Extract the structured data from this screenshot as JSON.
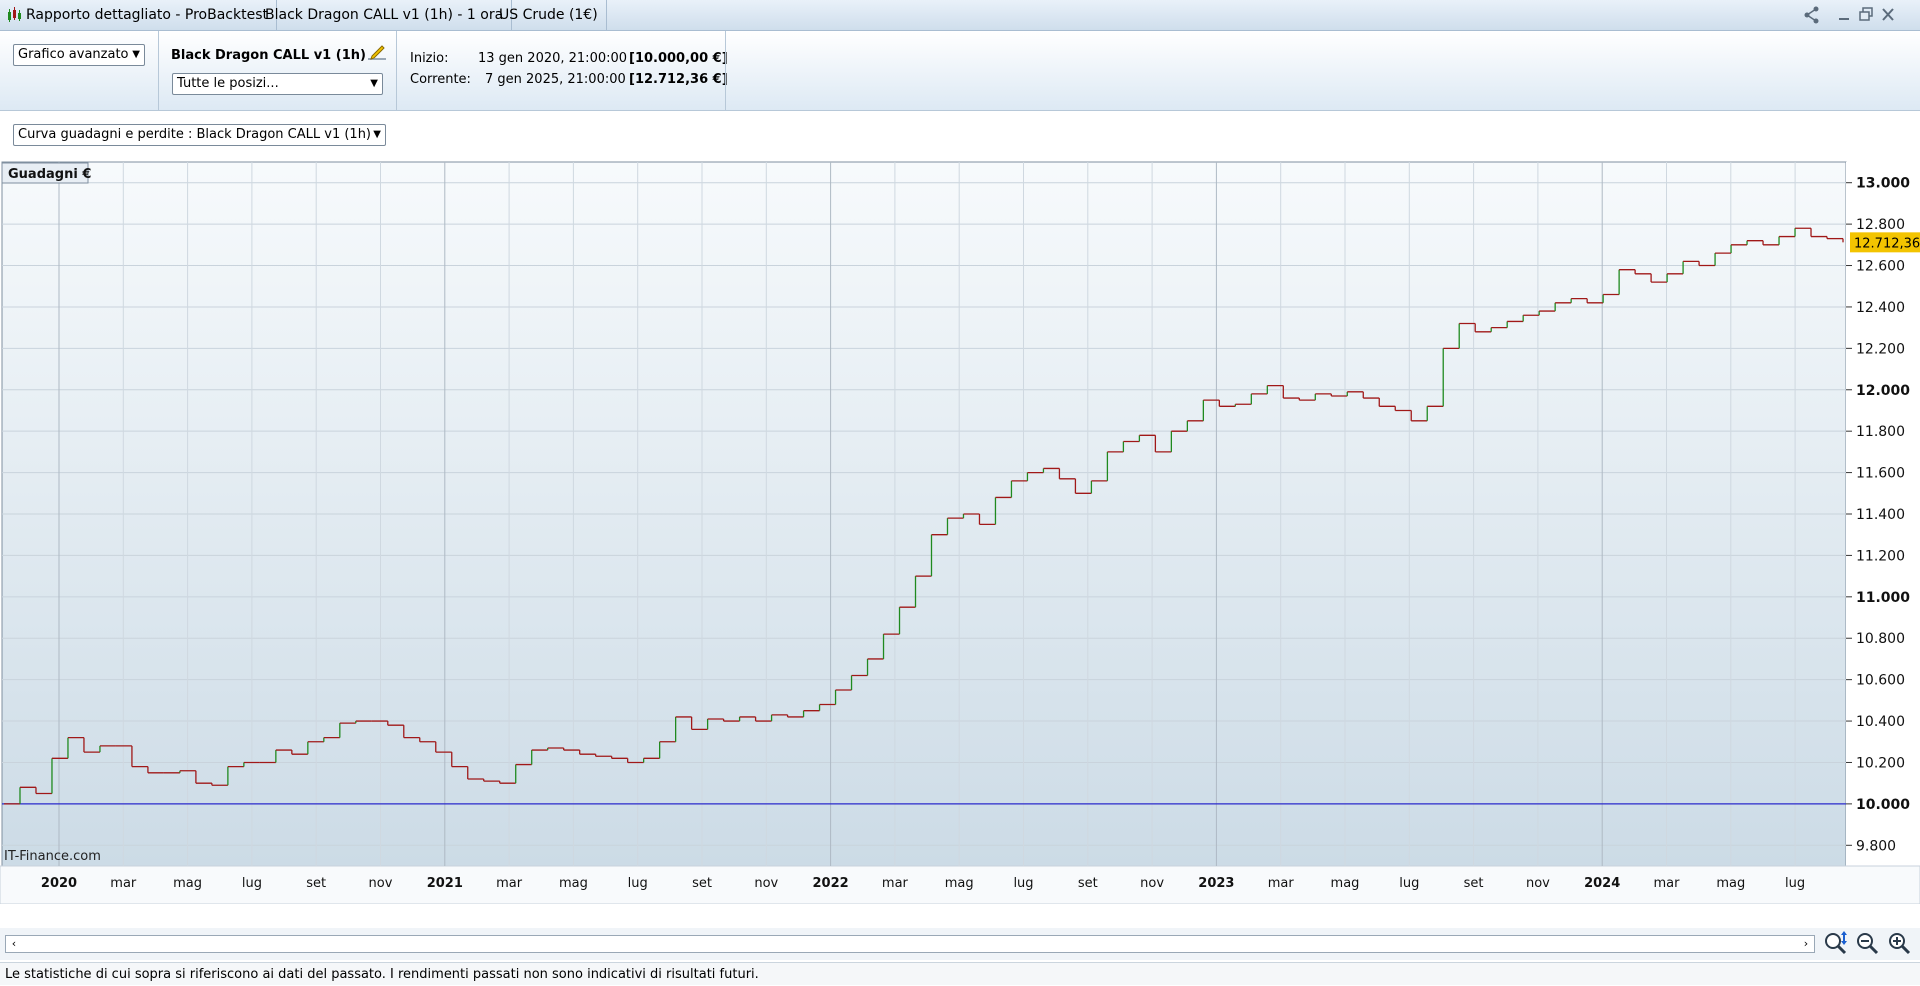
{
  "titlebar": {
    "tabs": [
      "Rapporto dettagliato - ProBacktest",
      "Black Dragon CALL v1 (1h) - 1 ora",
      "US Crude (1€)"
    ]
  },
  "header": {
    "view_select": "Grafico avanzato",
    "system_name": "Black Dragon CALL v1 (1h)",
    "positions_select": "Tutte le posizi...",
    "start_label": "Inizio:",
    "start_date": "13 gen 2020, 21:00:00",
    "start_value": "[10.000,00 €]",
    "current_label": "Corrente:",
    "current_date": "7 gen 2025, 21:00:00",
    "current_value": "[12.712,36 €]"
  },
  "curve_select": "Curva guadagni e perdite : Black Dragon CALL v1 (1h)",
  "chart_data": {
    "type": "line",
    "title": "Guadagni €",
    "current_value_label": "12.712,36",
    "watermark": "IT-Finance.com",
    "ylim": [
      9700,
      13100
    ],
    "y_ticks": [
      "9.800",
      "10.000",
      "10.200",
      "10.400",
      "10.600",
      "10.800",
      "11.000",
      "11.200",
      "11.400",
      "11.600",
      "11.800",
      "12.000",
      "12.200",
      "12.400",
      "12.600",
      "12.800",
      "13.000"
    ],
    "baseline": 10000,
    "x_ticks": [
      "2020",
      "mar",
      "mag",
      "lug",
      "set",
      "nov",
      "2021",
      "mar",
      "mag",
      "lug",
      "set",
      "nov",
      "2022",
      "mar",
      "mag",
      "lug",
      "set",
      "nov",
      "2023",
      "mar",
      "mag",
      "lug",
      "set",
      "nov",
      "2024",
      "mar",
      "mag",
      "lug"
    ],
    "x_bold": [
      "2020",
      "2021",
      "2022",
      "2023",
      "2024"
    ],
    "grid": true,
    "colors": {
      "up": "#1f8a1f",
      "down": "#a01818",
      "baseline": "#2a2acc",
      "label_bg": "#f3c400"
    },
    "series": [
      {
        "values": [
          10000,
          10080,
          10050,
          10220,
          10320,
          10250,
          10280,
          10280,
          10180,
          10150,
          10150,
          10160,
          10100,
          10090,
          10180,
          10200,
          10200,
          10260,
          10240,
          10300,
          10320,
          10390,
          10400,
          10400,
          10380,
          10320,
          10300,
          10250,
          10180,
          10120,
          10110,
          10100,
          10190,
          10260,
          10270,
          10260,
          10240,
          10230,
          10220,
          10200,
          10220,
          10300,
          10420,
          10360,
          10410,
          10400,
          10420,
          10400,
          10430,
          10420,
          10450,
          10480,
          10550,
          10620,
          10700,
          10820,
          10950,
          11100,
          11300,
          11380,
          11400,
          11350,
          11480,
          11560,
          11600,
          11620,
          11570,
          11500,
          11560,
          11700,
          11750,
          11780,
          11700,
          11800,
          11850,
          11950,
          11920,
          11930,
          11980,
          12020,
          11960,
          11950,
          11980,
          11970,
          11990,
          11960,
          11920,
          11900,
          11850,
          11920,
          12200,
          12320,
          12280,
          12300,
          12330,
          12360,
          12380,
          12420,
          12440,
          12420,
          12460,
          12580,
          12560,
          12520,
          12560,
          12620,
          12600,
          12660,
          12700,
          12720,
          12700,
          12740,
          12780,
          12740,
          12730,
          12712
        ]
      }
    ]
  },
  "scroll": {
    "left_arrow": "‹",
    "right_arrow": "›"
  },
  "zoom": {
    "fit_icon": "zoom-fit-icon",
    "out_icon": "zoom-out-icon",
    "in_icon": "zoom-in-icon"
  },
  "status_text": "Le statistiche di cui sopra si riferiscono ai dati del passato. I rendimenti passati non sono indicativi di risultati futuri."
}
